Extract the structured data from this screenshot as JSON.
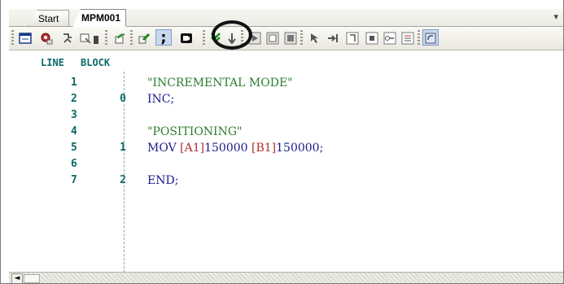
{
  "tabs": [
    {
      "label": "Start",
      "active": false
    },
    {
      "label": "MPM001",
      "active": true
    }
  ],
  "tab_menu_icon": "dropdown-arrow-icon",
  "toolbar": {
    "icons": [
      "panel-icon",
      "settings-gear-icon",
      "teach-icon",
      "print-icon",
      "dropdown-arrow-icon",
      "refresh-green-icon",
      "edit-pencil-icon",
      "semicolon-comment-icon",
      "circle-block-icon",
      "step-down-icon",
      "arrow-down-icon",
      "run-icon",
      "pause-icon",
      "stop-icon",
      "cursor-icon",
      "jump-icon",
      "frame-icon",
      "record-icon",
      "link-icon",
      "list-icon",
      "sync-icon"
    ],
    "semicolon_glyph": ";"
  },
  "editor": {
    "col_line": "LINE",
    "col_block": "BLOCK",
    "rows": [
      {
        "line": "1",
        "block": "",
        "code": [
          {
            "t": "\"INCREMENTAL MODE\"",
            "c": "cmt"
          }
        ]
      },
      {
        "line": "2",
        "block": "0",
        "code": [
          {
            "t": "INC;",
            "c": "kw"
          }
        ]
      },
      {
        "line": "3",
        "block": "",
        "code": []
      },
      {
        "line": "4",
        "block": "",
        "code": [
          {
            "t": "\"POSITIONING\"",
            "c": "cmt"
          }
        ]
      },
      {
        "line": "5",
        "block": "1",
        "code": [
          {
            "t": "MOV ",
            "c": "kw"
          },
          {
            "t": "[A1]",
            "c": "ax"
          },
          {
            "t": "150000 ",
            "c": "kw"
          },
          {
            "t": "[B1]",
            "c": "ax"
          },
          {
            "t": "150000;",
            "c": "kw"
          }
        ]
      },
      {
        "line": "6",
        "block": "",
        "code": []
      },
      {
        "line": "7",
        "block": "2",
        "code": [
          {
            "t": "END;",
            "c": "kw"
          }
        ]
      }
    ]
  },
  "scrollbar": {
    "left_arrow": "◄"
  }
}
